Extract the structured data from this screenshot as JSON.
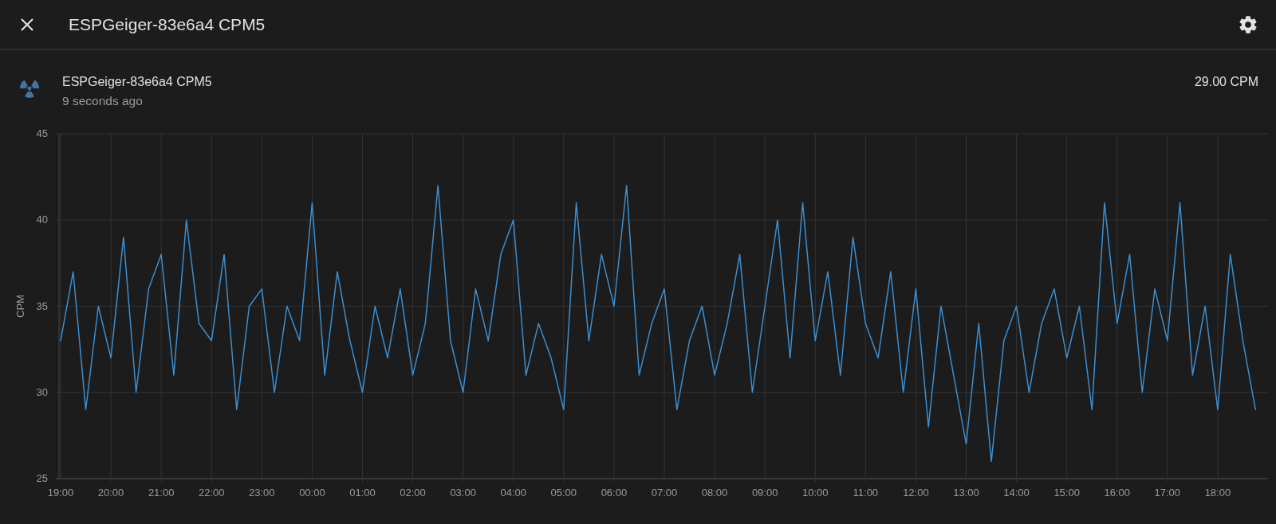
{
  "dialog": {
    "title": "ESPGeiger-83e6a4 CPM5"
  },
  "entity": {
    "name": "ESPGeiger-83e6a4 CPM5",
    "updated": "9 seconds ago",
    "state": "29.00 CPM"
  },
  "chart_data": {
    "type": "line",
    "grid": true,
    "ylabel": "CPM",
    "ylim": [
      25,
      45
    ],
    "yticks": [
      25,
      30,
      35,
      40,
      45
    ],
    "categories": [
      "19:00",
      null,
      null,
      null,
      "20:00",
      null,
      null,
      null,
      "21:00",
      null,
      null,
      null,
      "22:00",
      null,
      null,
      null,
      "23:00",
      null,
      null,
      null,
      "00:00",
      null,
      null,
      null,
      "01:00",
      null,
      null,
      null,
      "02:00",
      null,
      null,
      null,
      "03:00",
      null,
      null,
      null,
      "04:00",
      null,
      null,
      null,
      "05:00",
      null,
      null,
      null,
      "06:00",
      null,
      null,
      null,
      "07:00",
      null,
      null,
      null,
      "08:00",
      null,
      null,
      null,
      "09:00",
      null,
      null,
      null,
      "10:00",
      null,
      null,
      null,
      "11:00",
      null,
      null,
      null,
      "12:00",
      null,
      null,
      null,
      "13:00",
      null,
      null,
      null,
      "14:00",
      null,
      null,
      null,
      "15:00",
      null,
      null,
      null,
      "16:00",
      null,
      null,
      null,
      "17:00",
      null,
      null,
      null,
      "18:00",
      null,
      null,
      null
    ],
    "series": [
      {
        "color": "#3b8ed0",
        "values": [
          33,
          37,
          29,
          35,
          32,
          39,
          30,
          36,
          38,
          31,
          40,
          34,
          33,
          38,
          29,
          35,
          36,
          30,
          35,
          33,
          41,
          31,
          37,
          33,
          30,
          35,
          32,
          36,
          31,
          34,
          42,
          33,
          30,
          36,
          33,
          38,
          40,
          31,
          34,
          32,
          29,
          41,
          33,
          38,
          35,
          42,
          31,
          34,
          36,
          29,
          33,
          35,
          31,
          34,
          38,
          30,
          35,
          40,
          32,
          41,
          33,
          37,
          31,
          39,
          34,
          32,
          37,
          30,
          36,
          28,
          35,
          31,
          27,
          34,
          26,
          33,
          35,
          30,
          34,
          36,
          32,
          35,
          29,
          41,
          34,
          38,
          30,
          36,
          33,
          41,
          31,
          35,
          29,
          38,
          33,
          29
        ]
      }
    ]
  }
}
